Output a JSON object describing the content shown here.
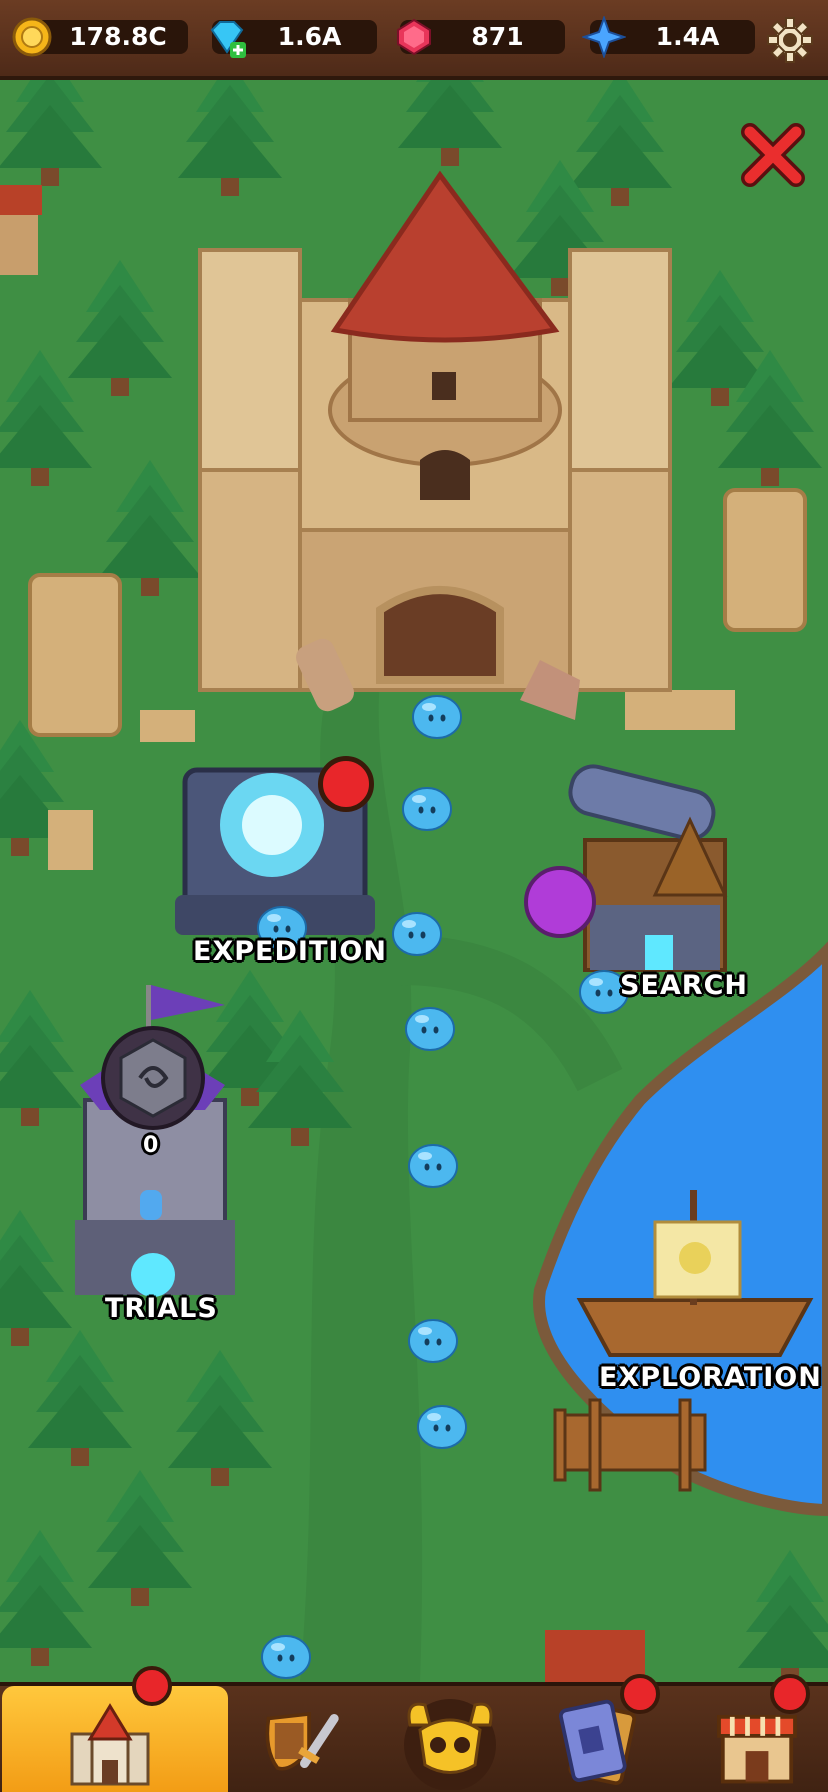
{
  "resources": [
    {
      "name": "coins",
      "icon": "coin-icon",
      "value": "178.8C",
      "color": "#f5b519"
    },
    {
      "name": "diamonds",
      "icon": "diamond-icon",
      "value": "1.6A",
      "color": "#37c6f5"
    },
    {
      "name": "gems",
      "icon": "ruby-icon",
      "value": "871",
      "color": "#e8355a"
    },
    {
      "name": "stars",
      "icon": "star-icon",
      "value": "1.4A",
      "color": "#4aa5ff"
    }
  ],
  "settings_icon": "gear-icon",
  "close_icon": "close-icon",
  "buildings": {
    "expedition": {
      "label": "EXPEDITION"
    },
    "research": {
      "label": "SEARCH"
    },
    "trials": {
      "label": "TRIALS",
      "count": "0"
    },
    "exploration": {
      "label": "EXPLORATION"
    }
  },
  "nav": [
    {
      "name": "castle",
      "icon": "castle-icon",
      "active": true,
      "badge": true
    },
    {
      "name": "equipment",
      "icon": "shield-sword-icon",
      "active": false,
      "badge": false
    },
    {
      "name": "boss",
      "icon": "skull-helmet-icon",
      "active": false,
      "badge": false
    },
    {
      "name": "cards",
      "icon": "card-icon",
      "active": false,
      "badge": true
    },
    {
      "name": "shop",
      "icon": "shop-icon",
      "active": false,
      "badge": true
    }
  ],
  "colors": {
    "grass": "#3f8f44",
    "path": "#3b8740",
    "water": "#2f8ff0",
    "alert": "#e8262a",
    "topbar": "#5a321c"
  }
}
